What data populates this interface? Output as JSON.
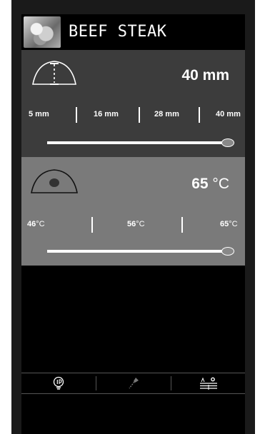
{
  "header": {
    "title": "BEEF STEAK",
    "thumbnail_icon": "steak-thumbnail"
  },
  "thickness": {
    "icon": "thickness-icon",
    "value": "40 mm",
    "ticks": [
      "5 mm",
      "16 mm",
      "28 mm",
      "40 mm"
    ],
    "slider_level": 1.0
  },
  "doneness": {
    "icon": "core-temperature-icon",
    "value_number": "65",
    "value_unit": "°C",
    "ticks": [
      {
        "num": "46",
        "unit": "°C"
      },
      {
        "num": "56",
        "unit": "°C"
      },
      {
        "num": "65",
        "unit": "°C"
      }
    ],
    "slider_level": 1.0
  },
  "toolbar": {
    "items": [
      "lightbulb-info-icon",
      "pin-icon",
      "settings-icon"
    ]
  },
  "colors": {
    "thickness_panel": "#3c3c3c",
    "temperature_panel": "#7a7a7a",
    "background": "#000000"
  }
}
